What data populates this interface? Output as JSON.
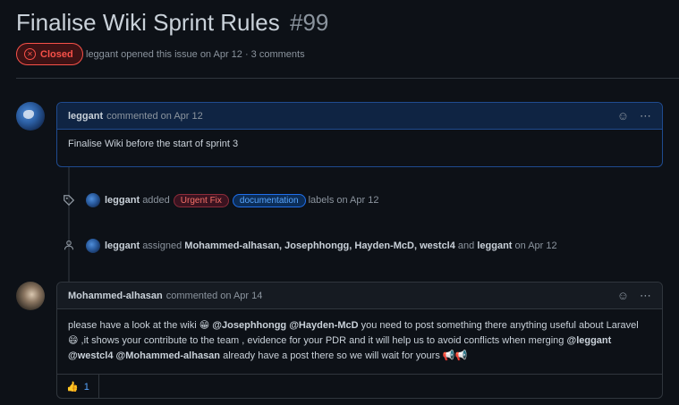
{
  "issue": {
    "title": "Finalise Wiki Sprint Rules",
    "number": "#99",
    "state": "Closed",
    "meta": "leggant opened this issue on Apr 12 · 3 comments"
  },
  "comment1": {
    "author": "leggant",
    "meta": "commented on Apr 12",
    "body": "Finalise Wiki before the start of sprint 3"
  },
  "event_labels": {
    "actor": "leggant",
    "verb": "added",
    "labels": [
      "Urgent Fix",
      "documentation"
    ],
    "suffix": "labels on Apr 12"
  },
  "event_assign": {
    "actor": "leggant",
    "verb": "assigned",
    "assignees": "Mohammed-alhasan, Josephhongg, Hayden-McD, westcl4",
    "and": "and",
    "last": "leggant",
    "suffix": "on Apr 12"
  },
  "comment2": {
    "author": "Mohammed-alhasan",
    "meta": "commented on Apr 14",
    "body_parts": {
      "p1": "please have a look at the wiki 😁",
      "m1": "@Josephhongg",
      "m2": "@Hayden-McD",
      "p2": "you need to post something there anything useful about Laravel 😄 ,it shows your contribute to the team , evidence for your PDR and it will help us to avoid conflicts when merging",
      "m3": "@leggant",
      "m4": "@westcl4",
      "m5": "@Mohammed-alhasan",
      "p3": "already have a post there so we will wait for yours 📢📢"
    },
    "reaction_emoji": "👍",
    "reaction_count": "1"
  },
  "icons": {
    "closed": "⊘",
    "smiley": "☺",
    "kebab": "⋯",
    "tag": "⌖",
    "person": "👤"
  }
}
